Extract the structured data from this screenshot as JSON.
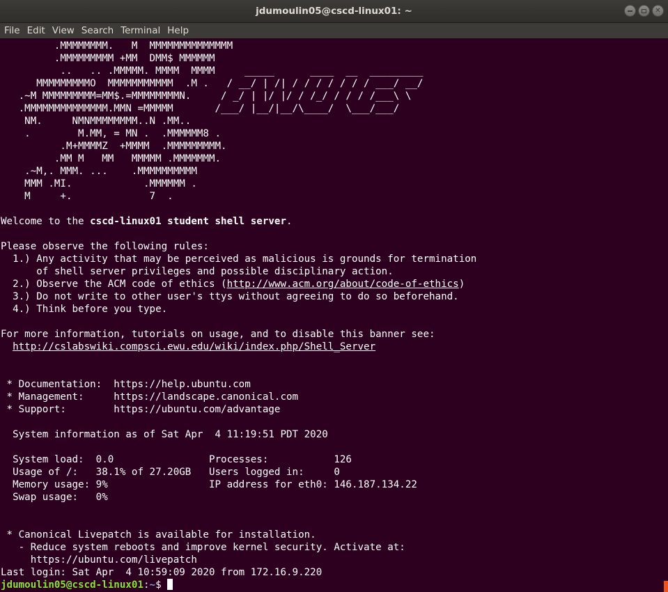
{
  "window": {
    "title": "jdumoulin05@cscd-linux01: ~",
    "buttons": [
      "minimize",
      "maximize",
      "close"
    ]
  },
  "menu": [
    "File",
    "Edit",
    "View",
    "Search",
    "Terminal",
    "Help"
  ],
  "terminal": {
    "colors": {
      "background": "#2c001e",
      "text": "#ffffff",
      "prompt_user": "#8ae234",
      "prompt_path": "#729fcf"
    },
    "banner": [
      "         .MMMMMMMM.   M  MMMMMMMMMMMMMM",
      "         .MMMMMMMMM +MM  DMM$ MMMMMM",
      "          ..   .. .MMMMM. MMMM  MMMM     _____      ____  __  _________",
      "      MMMMMMMMMO  MMMMMMMMMMM  .M .   / __/ | /| / / / / / / / ___/ __/",
      "   .~M MMMMMMMMM=MM$.=MMMMMMMMN.     / _/ | |/ |/ / /_/ / / / /___\\ \\",
      "   .MMMMMMMMMMMMMM.MMN =MMMMM       /___/ |__/|__/\\____/  \\___/___/",
      "    NM.     NMNMMMMMMMM..N .MM..",
      "    .        M.MM, = MN .  .MMMMMM8 .",
      "          .M+MMMMZ  +MMMM  .MMMMMMMMM.",
      "         .MM M   MM   MMMMM .MMMMMMM.",
      "    .~M,. MMM. ...    .MMMMMMMMMM",
      "    MMM .MI.            .MMMMMM .",
      "    M     +.             7  ."
    ],
    "welcome": {
      "prefix": "Welcome to the ",
      "bold": "cscd-linux01 student shell server",
      "suffix": "."
    },
    "rules_header": "Please observe the following rules:",
    "rule1a": "  1.) Any activity that may be perceived as malicious is grounds for termination",
    "rule1b": "      of shell server privileges and possible disciplinary action.",
    "rule2": {
      "prefix": "  2.) Observe the ACM code of ethics (",
      "link": "http://www.acm.org/about/code-of-ethics",
      "suffix": ")"
    },
    "rule3": "  3.) Do not write to other user's ttys without agreeing to do so beforehand.",
    "rule4": "  4.) Think before you type.",
    "more_info": "For more information, tutorials on usage, and to disable this banner see:",
    "wiki_link": "http://cslabswiki.compsci.ewu.edu/wiki/index.php/Shell_Server",
    "motd": [
      " * Documentation:  https://help.ubuntu.com",
      " * Management:     https://landscape.canonical.com",
      " * Support:        https://ubuntu.com/advantage"
    ],
    "sysinfo_title": "  System information as of Sat Apr  4 11:19:51 PDT 2020",
    "sysinfo": [
      "  System load:  0.0                Processes:           126",
      "  Usage of /:   38.1% of 27.20GB   Users logged in:     0",
      "  Memory usage: 9%                 IP address for eth0: 146.187.134.22",
      "  Swap usage:   0%"
    ],
    "livepatch": [
      " * Canonical Livepatch is available for installation.",
      "   - Reduce system reboots and improve kernel security. Activate at:",
      "     https://ubuntu.com/livepatch"
    ],
    "last_login": "Last login: Sat Apr  4 10:59:09 2020 from 172.16.9.220",
    "prompt": {
      "user_host": "jdumoulin05@cscd-linux01",
      "sep": ":",
      "path": "~",
      "symbol": "$ "
    }
  }
}
